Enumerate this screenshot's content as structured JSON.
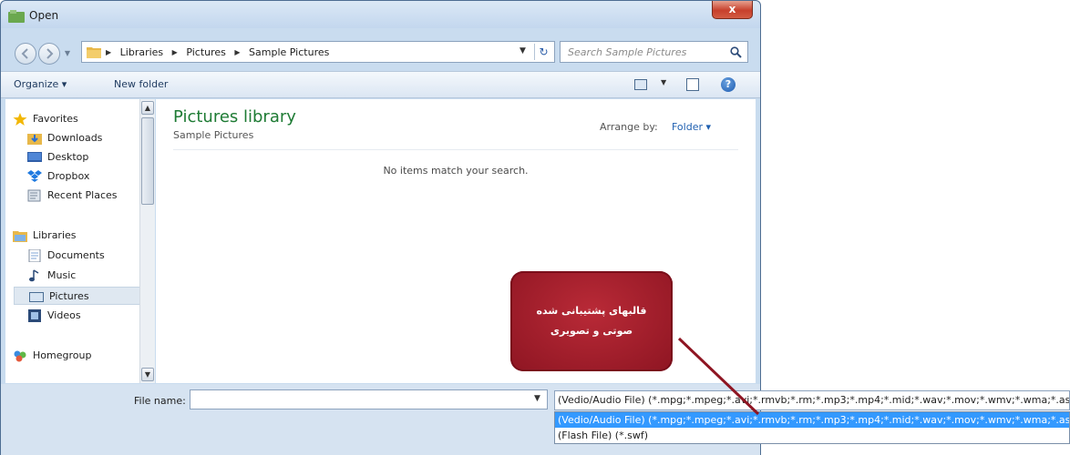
{
  "window": {
    "title": "Open",
    "close_label": "x"
  },
  "navbar": {
    "breadcrumbs": [
      "Libraries",
      "Pictures",
      "Sample Pictures"
    ],
    "search_placeholder": "Search Sample Pictures"
  },
  "toolbar": {
    "organize_label": "Organize ▾",
    "new_folder_label": "New folder"
  },
  "sidebar": {
    "items": [
      {
        "label": "Favorites",
        "icon": "star-icon"
      },
      {
        "label": "Downloads",
        "icon": "downloads-folder-icon"
      },
      {
        "label": "Desktop",
        "icon": "desktop-icon"
      },
      {
        "label": "Dropbox",
        "icon": "dropbox-icon"
      },
      {
        "label": "Recent Places",
        "icon": "recent-places-icon"
      },
      {
        "label": "Libraries",
        "icon": "libraries-icon"
      },
      {
        "label": "Documents",
        "icon": "documents-icon"
      },
      {
        "label": "Music",
        "icon": "music-icon"
      },
      {
        "label": "Pictures",
        "icon": "pictures-icon"
      },
      {
        "label": "Videos",
        "icon": "videos-icon"
      },
      {
        "label": "Homegroup",
        "icon": "homegroup-icon"
      }
    ],
    "selected": "Pictures"
  },
  "content": {
    "library_title": "Pictures library",
    "library_subtitle": "Sample Pictures",
    "arrange_by_label": "Arrange by:",
    "arrange_by_value": "Folder ▾",
    "empty_message": "No items match your search."
  },
  "bottom": {
    "file_name_label": "File name:",
    "file_name_value": "",
    "file_type_selected": "(Vedio/Audio File) (*.mpg;*.mpeg;*.avi;*.rmvb;*.rm;*.mp3;*.mp4;*.mid;*.wav;*.mov;*.wmv;*.wma;*.asf)",
    "file_type_options": [
      "(Vedio/Audio File) (*.mpg;*.mpeg;*.avi;*.rmvb;*.rm;*.mp3;*.mp4;*.mid;*.wav;*.mov;*.wmv;*.wma;*.asf)",
      "(Flash File) (*.swf)"
    ]
  },
  "callout": {
    "line1": "قالبهای پشتیبانی شده",
    "line2": "صوتی و تصویری"
  },
  "colors": {
    "library_title": "#1e7b34",
    "selection": "#3399ff",
    "callout": "#a11d2b"
  }
}
